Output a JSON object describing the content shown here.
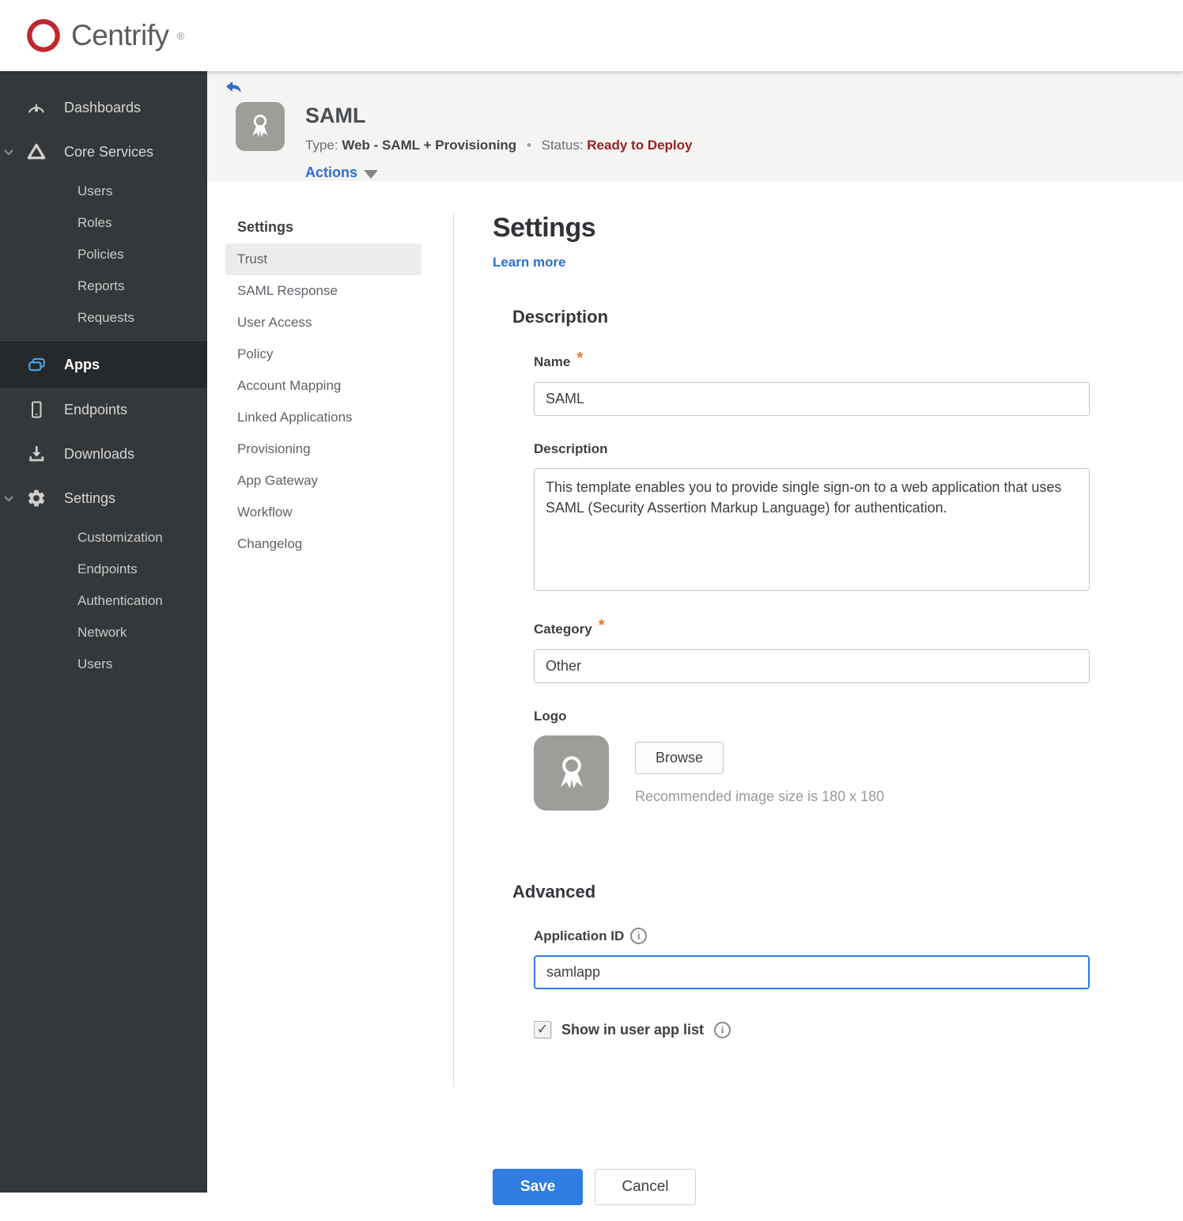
{
  "brand": {
    "name": "Centrify",
    "registered": "®"
  },
  "sidebar": {
    "items": [
      {
        "label": "Dashboards",
        "icon": "gauge-icon"
      },
      {
        "label": "Core Services",
        "icon": "core-services-icon",
        "expanded": true,
        "children": [
          "Users",
          "Roles",
          "Policies",
          "Reports",
          "Requests"
        ]
      },
      {
        "label": "Apps",
        "icon": "apps-icon",
        "active": true
      },
      {
        "label": "Endpoints",
        "icon": "phone-icon"
      },
      {
        "label": "Downloads",
        "icon": "download-icon"
      },
      {
        "label": "Settings",
        "icon": "gear-icon",
        "expanded": true,
        "children": [
          "Customization",
          "Endpoints",
          "Authentication",
          "Network",
          "Users"
        ]
      }
    ]
  },
  "app_header": {
    "title": "SAML",
    "type_label": "Type:",
    "type_value": "Web - SAML + Provisioning",
    "separator": "•",
    "status_label": "Status:",
    "status_value": "Ready to Deploy",
    "actions_label": "Actions"
  },
  "subnav": {
    "header": "Settings",
    "selected": "Trust",
    "items": [
      "Trust",
      "SAML Response",
      "User Access",
      "Policy",
      "Account Mapping",
      "Linked Applications",
      "Provisioning",
      "App Gateway",
      "Workflow",
      "Changelog"
    ]
  },
  "main": {
    "title": "Settings",
    "learn_more_label": "Learn more",
    "description_section": {
      "heading": "Description",
      "name_label": "Name",
      "name_value": "SAML",
      "description_label": "Description",
      "description_value": "This template enables you to provide single sign-on to a web application that uses SAML (Security Assertion Markup Language) for authentication.",
      "category_label": "Category",
      "category_value": "Other",
      "logo_label": "Logo",
      "browse_label": "Browse",
      "logo_hint": "Recommended image size is 180 x 180"
    },
    "advanced_section": {
      "heading": "Advanced",
      "app_id_label": "Application ID",
      "app_id_value": "samlapp",
      "show_in_app_list_label": "Show in user app list",
      "show_in_app_list_checked": true
    },
    "footer": {
      "save_label": "Save",
      "cancel_label": "Cancel"
    }
  },
  "colors": {
    "brand_red": "#c0272d",
    "sidebar_bg": "#35383b",
    "sidebar_active_bg": "#26292c",
    "accent_blue": "#2b6fd4",
    "apps_icon_blue": "#4aa3e0",
    "status_red": "#9c1f1f",
    "required_orange": "#e8762d",
    "header_band_bg": "#f4f4f2",
    "save_button_blue": "#2e7de0"
  }
}
